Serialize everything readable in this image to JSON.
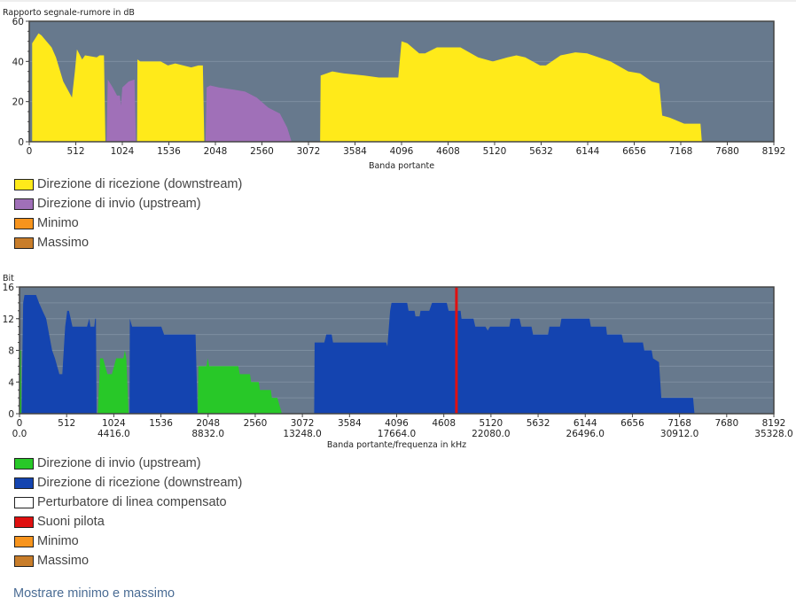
{
  "chart_data": [
    {
      "type": "area",
      "title": "Rapporto segnale-rumore in dB",
      "xlabel": "Banda portante",
      "ylabel": "Rapporto segnale-rumore in dB",
      "xlim": [
        0,
        8192
      ],
      "ylim": [
        0,
        60
      ],
      "xticks": [
        "0",
        "512",
        "1024",
        "1536",
        "2048",
        "2560",
        "3072",
        "3584",
        "4096",
        "4608",
        "5120",
        "5632",
        "6144",
        "6656",
        "7168",
        "7680",
        "8192"
      ],
      "yticks": [
        "0",
        "20",
        "40",
        "60"
      ],
      "grid": true,
      "series": [
        {
          "name": "Direzione di ricezione (downstream)",
          "color": "#ffea1a",
          "segments": [
            [
              [
                32,
                0
              ],
              [
                32,
                49
              ],
              [
                102,
                54
              ],
              [
                134,
                53
              ],
              [
                246,
                47
              ],
              [
                294,
                42
              ],
              [
                374,
                30
              ],
              [
                470,
                22
              ],
              [
                502,
                35
              ],
              [
                525,
                46
              ],
              [
                582,
                41
              ],
              [
                614,
                43
              ],
              [
                742,
                42
              ],
              [
                774,
                43
              ],
              [
                822,
                43
              ],
              [
                838,
                0
              ]
            ],
            [
              [
                1186,
                0
              ],
              [
                1190,
                41
              ],
              [
                1222,
                40
              ],
              [
                1446,
                40
              ],
              [
                1526,
                38
              ],
              [
                1606,
                39
              ],
              [
                1782,
                37
              ],
              [
                1862,
                38
              ],
              [
                1910,
                38
              ],
              [
                1926,
                0
              ]
            ],
            [
              [
                2736,
                0
              ],
              [
                2740,
                14
              ],
              [
                2746,
                14
              ],
              [
                2750,
                0
              ]
            ],
            [
              [
                3200,
                0
              ],
              [
                3206,
                33
              ],
              [
                3334,
                35
              ],
              [
                3462,
                34
              ],
              [
                3686,
                33
              ],
              [
                3846,
                32
              ],
              [
                4060,
                32
              ],
              [
                4096,
                50
              ],
              [
                4160,
                49
              ],
              [
                4290,
                44
              ],
              [
                4355,
                44
              ],
              [
                4485,
                47
              ],
              [
                4550,
                47
              ],
              [
                4744,
                47
              ],
              [
                4938,
                42
              ],
              [
                5100,
                40
              ],
              [
                5262,
                42
              ],
              [
                5360,
                43
              ],
              [
                5457,
                42
              ],
              [
                5620,
                38
              ],
              [
                5684,
                38
              ],
              [
                5846,
                43
              ],
              [
                6008,
                44.5
              ],
              [
                6137,
                44
              ],
              [
                6396,
                40
              ],
              [
                6590,
                35
              ],
              [
                6720,
                34
              ],
              [
                6850,
                30
              ],
              [
                6930,
                29
              ],
              [
                6964,
                13
              ],
              [
                7045,
                12
              ],
              [
                7206,
                9
              ],
              [
                7385,
                9
              ],
              [
                7400,
                0
              ]
            ]
          ]
        },
        {
          "name": "Direzione di invio (upstream)",
          "color": "#a070b8",
          "segments": [
            [
              [
                850,
                0
              ],
              [
                864,
                31
              ],
              [
                918,
                27
              ],
              [
                966,
                23
              ],
              [
                998,
                23
              ],
              [
                1008,
                18
              ],
              [
                1024,
                27
              ],
              [
                1094,
                30
              ],
              [
                1158,
                31
              ],
              [
                1174,
                0
              ]
            ],
            [
              [
                1940,
                0
              ],
              [
                1952,
                27
              ],
              [
                1990,
                28
              ],
              [
                2086,
                27
              ],
              [
                2246,
                26
              ],
              [
                2374,
                25
              ],
              [
                2502,
                22
              ],
              [
                2630,
                17
              ],
              [
                2758,
                14
              ],
              [
                2838,
                7
              ],
              [
                2886,
                0
              ]
            ]
          ]
        },
        {
          "name": "Minimo",
          "color": "#f7941d",
          "segments": []
        },
        {
          "name": "Massimo",
          "color": "#c87d2a",
          "segments": []
        }
      ]
    },
    {
      "type": "area",
      "title": "Bit",
      "xlabel": "Banda portante/frequenza in kHz",
      "ylabel": "Bit",
      "xlim": [
        0,
        8192
      ],
      "ylim": [
        0,
        16
      ],
      "xticks": [
        "0",
        "512",
        "1024",
        "1536",
        "2048",
        "2560",
        "3072",
        "3584",
        "4096",
        "4608",
        "5120",
        "5632",
        "6144",
        "6656",
        "7168",
        "7680",
        "8192"
      ],
      "xticks_freq": [
        "0.0",
        "",
        "4416.0",
        "",
        "8832.0",
        "",
        "13248.0",
        "",
        "17664.0",
        "",
        "22080.0",
        "",
        "26496.0",
        "",
        "30912.0",
        "",
        "35328.0"
      ],
      "yticks": [
        "0",
        "4",
        "8",
        "12",
        "16"
      ],
      "grid": true,
      "series": [
        {
          "name": "Direzione di invio (upstream)",
          "color": "#28c828",
          "segments": [
            [
              [
                0,
                0
              ],
              [
                4,
                8
              ],
              [
                16,
                8
              ],
              [
                20,
                0
              ]
            ],
            [
              [
                850,
                0
              ],
              [
                875,
                7
              ],
              [
                907,
                7
              ],
              [
                955,
                5
              ],
              [
                1003,
                5
              ],
              [
                1050,
                7
              ],
              [
                1128,
                7
              ],
              [
                1144,
                8
              ],
              [
                1160,
                7
              ],
              [
                1185,
                0
              ]
            ],
            [
              [
                1935,
                0
              ],
              [
                1943,
                6
              ],
              [
                2030,
                6
              ],
              [
                2045,
                7
              ],
              [
                2060,
                6
              ],
              [
                2376,
                6
              ],
              [
                2392,
                5
              ],
              [
                2503,
                5
              ],
              [
                2515,
                4
              ],
              [
                2598,
                4
              ],
              [
                2610,
                3
              ],
              [
                2730,
                3
              ],
              [
                2740,
                2
              ],
              [
                2800,
                2
              ],
              [
                2850,
                0
              ]
            ]
          ]
        },
        {
          "name": "Direzione di ricezione (downstream)",
          "color": "#1444b0",
          "segments": [
            [
              [
                22,
                0
              ],
              [
                40,
                14
              ],
              [
                54,
                15
              ],
              [
                180,
                15
              ],
              [
                212,
                14
              ],
              [
                250,
                13
              ],
              [
                290,
                12
              ],
              [
                354,
                8
              ],
              [
                385,
                7
              ],
              [
                433,
                5
              ],
              [
                465,
                5
              ],
              [
                496,
                11
              ],
              [
                518,
                13
              ],
              [
                537,
                13
              ],
              [
                575,
                11
              ],
              [
                733,
                11
              ],
              [
                758,
                12
              ],
              [
                770,
                11
              ],
              [
                812,
                11
              ],
              [
                822,
                12
              ],
              [
                830,
                12
              ],
              [
                837,
                0
              ]
            ],
            [
              [
                1195,
                0
              ],
              [
                1198,
                12
              ],
              [
                1223,
                11
              ],
              [
                1540,
                11
              ],
              [
                1570,
                10
              ],
              [
                1912,
                10
              ],
              [
                1934,
                0
              ]
            ],
            [
              [
                3200,
                0
              ],
              [
                3205,
                9
              ],
              [
                3310,
                9
              ],
              [
                3332,
                10
              ],
              [
                3390,
                10
              ],
              [
                3405,
                9
              ],
              [
                3982,
                9
              ],
              [
                3995,
                8.5
              ],
              [
                4025,
                13
              ],
              [
                4040,
                14
              ],
              [
                4210,
                14
              ],
              [
                4225,
                13
              ],
              [
                4290,
                13
              ],
              [
                4300,
                12.3
              ],
              [
                4345,
                12.3
              ],
              [
                4355,
                13
              ],
              [
                4450,
                13
              ],
              [
                4480,
                14
              ],
              [
                4640,
                14
              ],
              [
                4660,
                13
              ],
              [
                4790,
                13
              ],
              [
                4800,
                12
              ],
              [
                4930,
                12
              ],
              [
                4950,
                11
              ],
              [
                5060,
                11
              ],
              [
                5085,
                10.5
              ],
              [
                5110,
                11
              ],
              [
                5320,
                11
              ],
              [
                5335,
                12
              ],
              [
                5430,
                12
              ],
              [
                5450,
                11
              ],
              [
                5560,
                11
              ],
              [
                5577,
                10
              ],
              [
                5740,
                10
              ],
              [
                5755,
                11
              ],
              [
                5870,
                11
              ],
              [
                5885,
                12
              ],
              [
                6190,
                12
              ],
              [
                6205,
                11
              ],
              [
                6370,
                11
              ],
              [
                6380,
                10
              ],
              [
                6540,
                10
              ],
              [
                6560,
                9
              ],
              [
                6770,
                9
              ],
              [
                6785,
                8
              ],
              [
                6865,
                8
              ],
              [
                6880,
                7
              ],
              [
                6945,
                6.5
              ],
              [
                6970,
                2
              ],
              [
                7315,
                2
              ],
              [
                7330,
                0
              ]
            ]
          ]
        },
        {
          "name": "Perturbatore di linea compensato",
          "color": "#ffffff",
          "segments": []
        },
        {
          "name": "Suoni pilota",
          "color": "#e01010",
          "lines": [
            4745
          ]
        },
        {
          "name": "Minimo",
          "color": "#f7941d",
          "segments": []
        },
        {
          "name": "Massimo",
          "color": "#c87d2a",
          "segments": []
        }
      ]
    }
  ],
  "show_minmax_link": "Mostrare minimo e massimo"
}
